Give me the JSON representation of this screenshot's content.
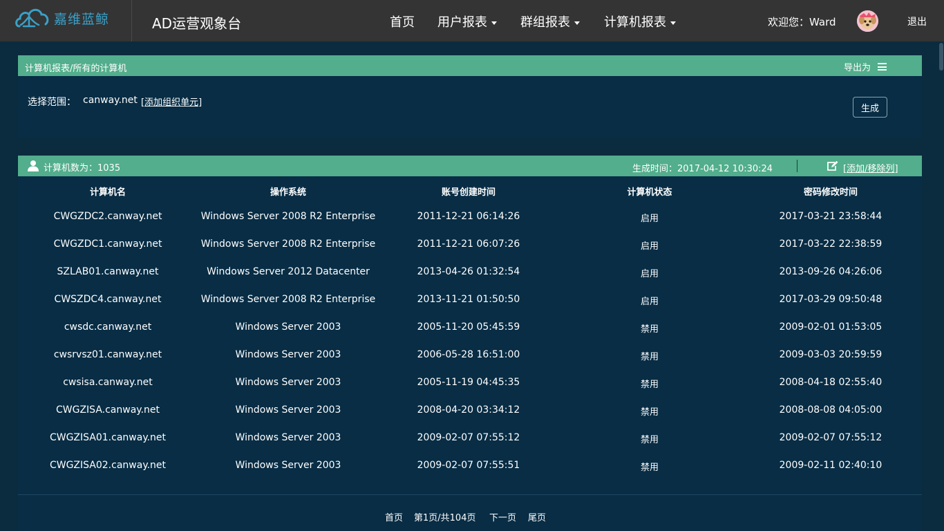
{
  "header": {
    "logo_text": "嘉维蓝鲸",
    "app_title": "AD运营观象台",
    "nav": [
      {
        "label": "首页",
        "dropdown": false
      },
      {
        "label": "用户报表",
        "dropdown": true
      },
      {
        "label": "群组报表",
        "dropdown": true
      },
      {
        "label": "计算机报表",
        "dropdown": true
      }
    ],
    "welcome": "欢迎您：Ward",
    "logout": "退出"
  },
  "filter_panel": {
    "breadcrumb": "计算机报表/所有的计算机",
    "export_label": "导出为",
    "scope_label": "选择范围：",
    "scope_value": "canway.net",
    "add_ou_label": "[添加组织单元]",
    "generate_label": "生成"
  },
  "report_panel": {
    "count_text": "计算机数为：1035",
    "generated_text": "生成时间：2017-04-12 10:30:24",
    "add_column_label": "[添加/移除列]",
    "columns": [
      "计算机名",
      "操作系统",
      "账号创建时间",
      "计算机状态",
      "密码修改时间"
    ],
    "rows": [
      [
        "CWGZDC2.canway.net",
        "Windows Server 2008 R2 Enterprise",
        "2011-12-21 06:14:26",
        "启用",
        "2017-03-21 23:58:44"
      ],
      [
        "CWGZDC1.canway.net",
        "Windows Server 2008 R2 Enterprise",
        "2011-12-21 06:07:26",
        "启用",
        "2017-03-22 22:38:59"
      ],
      [
        "SZLAB01.canway.net",
        "Windows Server 2012 Datacenter",
        "2013-04-26 01:32:54",
        "启用",
        "2013-09-26 04:26:06"
      ],
      [
        "CWSZDC4.canway.net",
        "Windows Server 2008 R2 Enterprise",
        "2013-11-21 01:50:50",
        "启用",
        "2017-03-29 09:50:48"
      ],
      [
        "cwsdc.canway.net",
        "Windows Server 2003",
        "2005-11-20 05:45:59",
        "禁用",
        "2009-02-01 01:53:05"
      ],
      [
        "cwsrvsz01.canway.net",
        "Windows Server 2003",
        "2006-05-28 16:51:00",
        "禁用",
        "2009-03-03 20:59:59"
      ],
      [
        "cwsisa.canway.net",
        "Windows Server 2003",
        "2005-11-19 04:45:35",
        "禁用",
        "2008-04-18 02:55:40"
      ],
      [
        "CWGZISA.canway.net",
        "Windows Server 2003",
        "2008-04-20 03:34:12",
        "禁用",
        "2008-08-08 04:05:00"
      ],
      [
        "CWGZISA01.canway.net",
        "Windows Server 2003",
        "2009-02-07 07:55:12",
        "禁用",
        "2009-02-07 07:55:12"
      ],
      [
        "CWGZISA02.canway.net",
        "Windows Server 2003",
        "2009-02-07 07:55:51",
        "禁用",
        "2009-02-11 02:40:10"
      ]
    ],
    "pager": {
      "first": "首页",
      "current": "第1页/共104页",
      "next": "下一页",
      "last": "尾页"
    }
  },
  "colors": {
    "topbar": "#343434",
    "panel_header": "#52ae8c",
    "panel_body": "#082d45",
    "page_bg": "#0b2b3f",
    "logo": "#3aa0c8"
  },
  "icons": [
    "cloud-logo-icon",
    "chevron-down-icon",
    "menu-icon",
    "user-icon",
    "edit-icon",
    "avatar-dog-icon"
  ]
}
